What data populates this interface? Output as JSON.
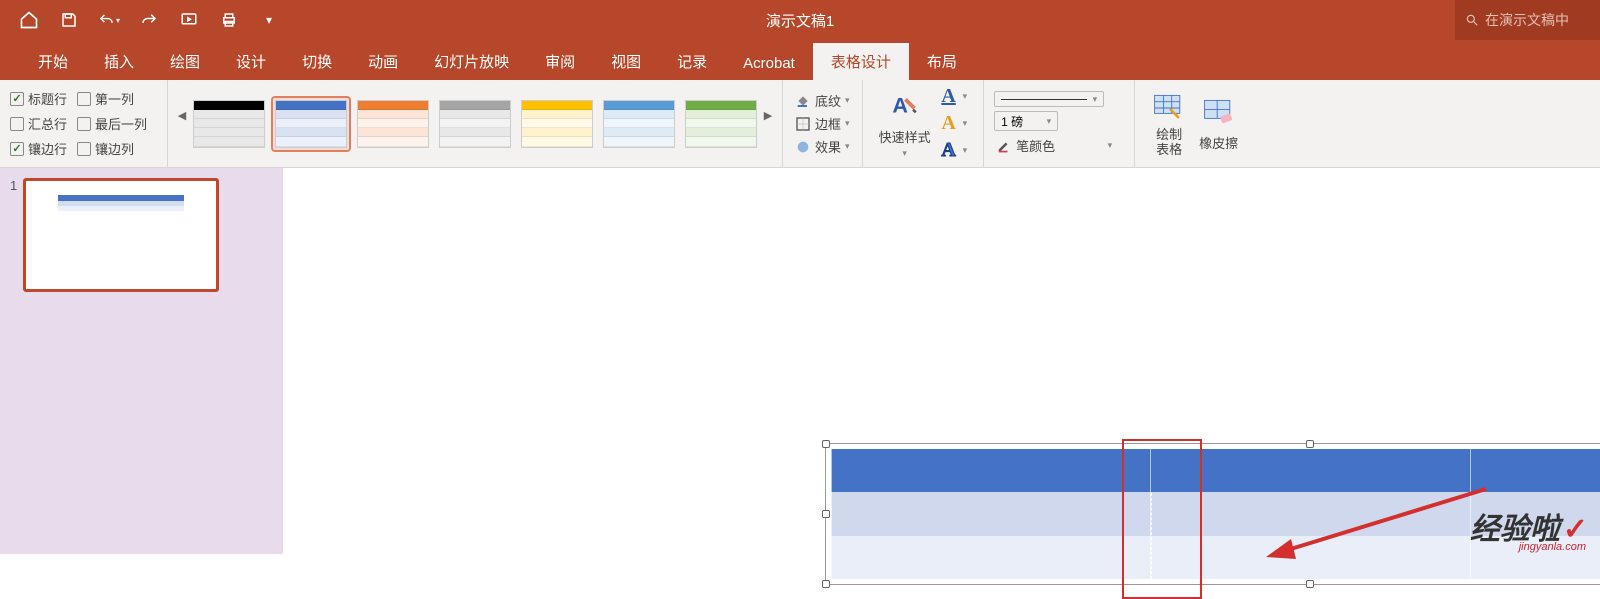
{
  "app": {
    "title": "演示文稿1",
    "search_placeholder": "在演示文稿中"
  },
  "tabs": [
    "开始",
    "插入",
    "绘图",
    "设计",
    "切换",
    "动画",
    "幻灯片放映",
    "审阅",
    "视图",
    "记录",
    "Acrobat",
    "表格设计",
    "布局"
  ],
  "tabs_active_index": 11,
  "ribbon": {
    "opts_col1": [
      {
        "label": "标题行",
        "checked": true
      },
      {
        "label": "汇总行",
        "checked": false
      },
      {
        "label": "镶边行",
        "checked": true
      }
    ],
    "opts_col2": [
      {
        "label": "第一列",
        "checked": false
      },
      {
        "label": "最后一列",
        "checked": false
      },
      {
        "label": "镶边列",
        "checked": false
      }
    ],
    "shading": "底纹",
    "border": "边框",
    "effects": "效果",
    "quick_styles": "快速样式",
    "pen_weight": "1 磅",
    "pen_color": "笔颜色",
    "draw_table": "绘制\n表格",
    "eraser": "橡皮擦"
  },
  "slide": {
    "number": "1"
  },
  "watermark": {
    "text": "经验啦",
    "url": "jingyanla.com"
  }
}
